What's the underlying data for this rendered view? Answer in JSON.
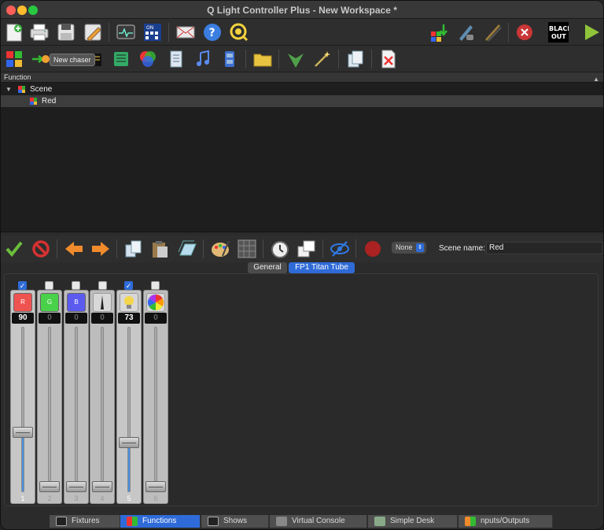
{
  "window": {
    "title": "Q Light Controller Plus - New Workspace *"
  },
  "toolbar_main": {
    "icons": [
      "new-workspace-icon",
      "print-icon",
      "save-icon",
      "save-as-icon",
      "monitor-icon",
      "dmx-dump-icon",
      "address-tool-icon",
      "help-icon",
      "check-update-icon",
      "fixture-remap-icon",
      "blind-mode-icon",
      "script-icon",
      "stop-all-icon",
      "blackout-icon",
      "operate-mode-icon"
    ],
    "blackout_label": "BLACK OUT"
  },
  "toolbar_functions": {
    "icons": [
      "new-scene-icon",
      "new-chaser-icon",
      "new-sequence-icon",
      "new-efx-icon",
      "new-collection-icon",
      "new-rgb-matrix-icon",
      "new-script-icon",
      "new-audio-icon",
      "new-video-icon",
      "new-folder-icon",
      "function-wizard-icon",
      "clone-function-icon",
      "delete-function-icon"
    ],
    "tooltip": "New chaser"
  },
  "function_panel": {
    "header": "Function",
    "tree": [
      {
        "label": "Scene",
        "expanded": true,
        "depth": 0
      },
      {
        "label": "Red",
        "depth": 1,
        "selected": true
      }
    ]
  },
  "editor_toolbar": {
    "icons": [
      "apply-icon",
      "cancel-icon",
      "previous-icon",
      "next-icon",
      "copy-icon",
      "paste-icon",
      "copy-all-icon",
      "palette-icon",
      "grid-icon",
      "speed-dial-icon",
      "fixture-group-icon",
      "visibility-icon",
      "record-icon"
    ],
    "mode_select": "None",
    "scene_name_label": "Scene name:",
    "scene_name_value": "Red"
  },
  "tabs": [
    {
      "label": "General",
      "active": false
    },
    {
      "label": "FP1 Titan Tube",
      "active": true
    }
  ],
  "channels": [
    {
      "number": "1",
      "checked": true,
      "value": "90",
      "level": 0.353,
      "icon": "R",
      "color": "#ef5350",
      "enabled": true
    },
    {
      "number": "2",
      "checked": false,
      "value": "0",
      "level": 0,
      "icon": "G",
      "color": "#4ad14a",
      "enabled": false
    },
    {
      "number": "3",
      "checked": false,
      "value": "0",
      "level": 0,
      "icon": "B",
      "color": "#5b5bf0",
      "enabled": false
    },
    {
      "number": "4",
      "checked": false,
      "value": "0",
      "level": 0,
      "icon": "shutter-icon",
      "color": "#444444",
      "enabled": false
    },
    {
      "number": "5",
      "checked": true,
      "value": "73",
      "level": 0.286,
      "icon": "bulb-icon",
      "color": "#f5d54a",
      "enabled": true
    },
    {
      "number": "6",
      "checked": false,
      "value": "0",
      "level": 0,
      "icon": "color-wheel-icon",
      "color": "#ffffff",
      "enabled": false
    }
  ],
  "bottom_tabs": [
    {
      "label": "Fixtures",
      "active": false,
      "icon": "fixtures-icon"
    },
    {
      "label": "Functions",
      "active": true,
      "icon": "functions-icon"
    },
    {
      "label": "Shows",
      "active": false,
      "icon": "shows-icon"
    },
    {
      "label": "Virtual Console",
      "active": false,
      "icon": "virtual-console-icon"
    },
    {
      "label": "Simple Desk",
      "active": false,
      "icon": "simple-desk-icon"
    },
    {
      "label": "nputs/Outputs",
      "active": false,
      "icon": "inputs-outputs-icon"
    }
  ]
}
